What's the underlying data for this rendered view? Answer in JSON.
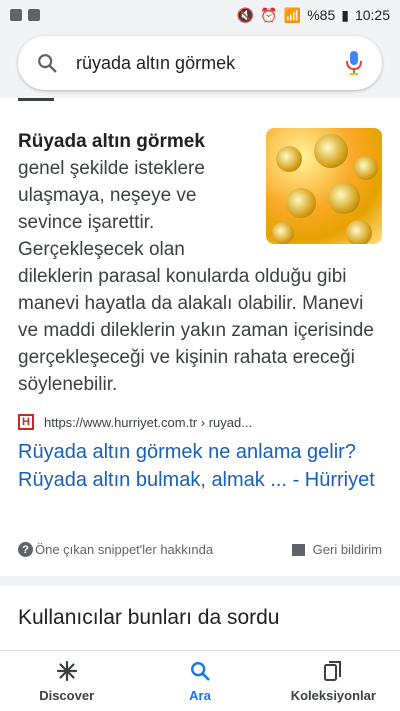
{
  "status_bar": {
    "battery": "%85",
    "time": "10:25"
  },
  "search": {
    "query": "rüyada altın görmek"
  },
  "snippet": {
    "bold": "Rüyada altın görmek",
    "text": " genel şekilde isteklere ulaşmaya, neşeye ve sevince işarettir. Gerçekleşecek olan dileklerin parasal konularda olduğu gibi manevi hayatla da alakalı olabilir. Manevi ve maddi dileklerin yakın zaman içerisinde gerçekleşeceği ve kişinin rahata ereceği söylenebilir."
  },
  "source": {
    "favicon": "H",
    "url": "https://www.hurriyet.com.tr › ruyad..."
  },
  "result": {
    "title": "Rüyada altın görmek ne anlama gelir? Rüyada altın bulmak, almak ... - Hürriyet"
  },
  "footer": {
    "about": "Öne çıkan snippet'ler hakkında",
    "feedback": "Geri bildirim"
  },
  "paa": {
    "title": "Kullanıcılar bunları da sordu"
  },
  "nav": [
    {
      "label": "Discover",
      "icon": "asterisk-icon"
    },
    {
      "label": "Ara",
      "icon": "search-icon"
    },
    {
      "label": "Koleksiyonlar",
      "icon": "collections-icon"
    }
  ],
  "colors": {
    "link": "#1a5fb4",
    "accent": "#1a73e8"
  }
}
